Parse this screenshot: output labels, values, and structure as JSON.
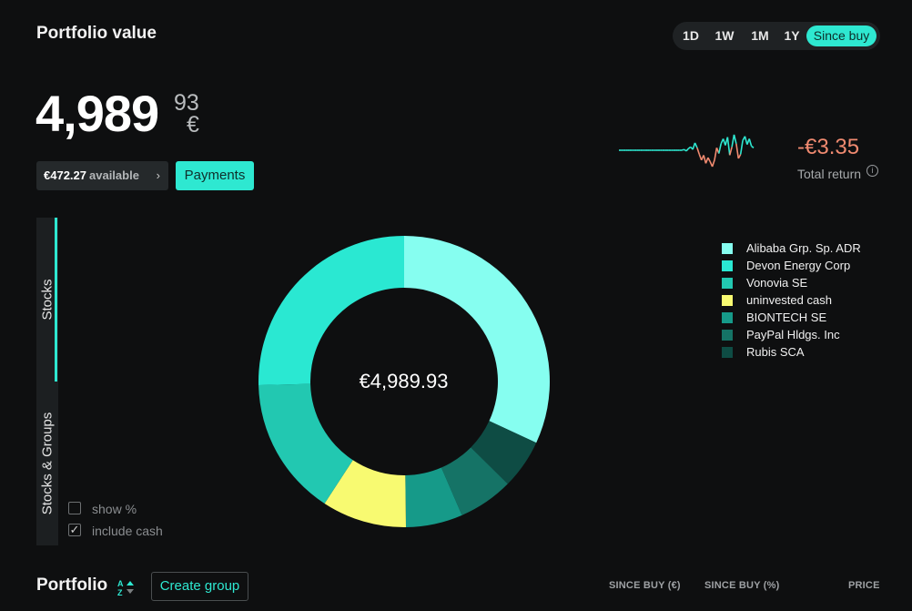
{
  "header": {
    "title": "Portfolio value"
  },
  "time_range": {
    "options": [
      "1D",
      "1W",
      "1M",
      "1Y",
      "Since buy"
    ],
    "active": "Since buy"
  },
  "value": {
    "whole": "4,989",
    "cents": "93",
    "currency": "€"
  },
  "available": {
    "amount": "€472.27",
    "label": "available",
    "chevron": "›"
  },
  "payments_label": "Payments",
  "total_return": {
    "value": "-€3.35",
    "label": "Total return",
    "info_glyph": "i"
  },
  "view_tabs": [
    "Stocks",
    "Stocks & Groups"
  ],
  "options": {
    "show_percent": "show %",
    "include_cash": "include cash",
    "include_cash_checked": true,
    "show_percent_checked": false,
    "check_glyph": "✓"
  },
  "donut": {
    "center_label": "€4,989.93",
    "segments": [
      {
        "name": "Alibaba Grp. Sp. ADR",
        "share": 0.319,
        "color": "#86fef0"
      },
      {
        "name": "Rubis SCA",
        "share": 0.055,
        "color": "#0e4c44"
      },
      {
        "name": "PayPal Hldgs. Inc",
        "share": 0.061,
        "color": "#157366"
      },
      {
        "name": "BIONTECH SE",
        "share": 0.063,
        "color": "#169a89"
      },
      {
        "name": "uninvested cash",
        "share": 0.094,
        "color": "#f8fa71"
      },
      {
        "name": "Vonovia SE",
        "share": 0.154,
        "color": "#22c8b1"
      },
      {
        "name": "Devon Energy Corp",
        "share": 0.254,
        "color": "#2ae8d2"
      }
    ]
  },
  "legend": [
    {
      "label": "Alibaba Grp. Sp. ADR",
      "color": "#86fef0"
    },
    {
      "label": "Devon Energy Corp",
      "color": "#2ae8d2"
    },
    {
      "label": "Vonovia SE",
      "color": "#22c8b1"
    },
    {
      "label": "uninvested cash",
      "color": "#f8fa71"
    },
    {
      "label": "BIONTECH SE",
      "color": "#169a89"
    },
    {
      "label": "PayPal Hldgs. Inc",
      "color": "#157366"
    },
    {
      "label": "Rubis SCA",
      "color": "#0e4c44"
    }
  ],
  "portfolio": {
    "title": "Portfolio",
    "create_group": "Create group",
    "columns": [
      "SINCE BUY (€)",
      "SINCE BUY (%)",
      "PRICE"
    ]
  },
  "colors": {
    "accent": "#2ee8d1",
    "negative": "#f08a70",
    "background": "#0e0f10"
  },
  "sparkline": {
    "baseline": 0,
    "values": [
      0,
      0,
      0,
      0,
      0,
      0,
      0,
      0,
      0,
      0,
      0,
      0,
      0,
      0,
      0,
      0,
      0,
      0,
      0,
      0,
      0,
      0,
      0,
      0,
      0,
      0,
      0,
      0,
      0,
      0,
      0.1,
      -0.1,
      0.2,
      0.4,
      0.1,
      0.9,
      0.3,
      -0.5,
      -1.2,
      -0.6,
      -1.6,
      -0.9,
      -1.4,
      -2.0,
      -1.2,
      0.3,
      -0.4,
      0.8,
      1.4,
      0.6,
      1.6,
      -0.6,
      0.4,
      1.9,
      0.8,
      -1.0,
      -0.5,
      1.2,
      1.7,
      0.7,
      1.4,
      0.5,
      0.3
    ],
    "icons": [
      "sparkline-chart"
    ]
  }
}
